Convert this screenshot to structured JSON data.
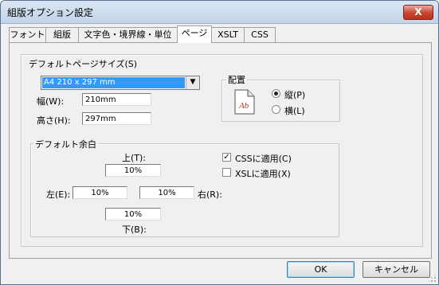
{
  "window": {
    "title": "組版オプション設定",
    "close_label": "X"
  },
  "tabs": [
    {
      "label": "フォント",
      "active": false
    },
    {
      "label": "組版",
      "active": false
    },
    {
      "label": "文字色・境界線・単位",
      "active": false
    },
    {
      "label": "ページ",
      "active": true
    },
    {
      "label": "XSLT",
      "active": false
    },
    {
      "label": "CSS",
      "active": false
    }
  ],
  "page_size": {
    "group_label": "デフォルトページサイズ(S)",
    "selected": "A4 210 x 297 mm",
    "width_label": "幅(W):",
    "width_value": "210mm",
    "height_label": "高さ(H):",
    "height_value": "297mm"
  },
  "orientation": {
    "group_label": "配置",
    "page_icon_text": "Ab",
    "portrait_label": "縦(P)",
    "landscape_label": "横(L)",
    "selected": "portrait"
  },
  "margins": {
    "group_label": "デフォルト余白",
    "top_label": "上(T):",
    "top_value": "10%",
    "left_label": "左(E):",
    "left_value": "10%",
    "right_label": "右(R):",
    "right_value": "10%",
    "bottom_label": "下(B):",
    "bottom_value": "10%",
    "css_label": "CSSに適用(C)",
    "css_checked": true,
    "xsl_label": "XSLに適用(X)",
    "xsl_checked": false,
    "check_mark": "✓"
  },
  "buttons": {
    "ok": "OK",
    "cancel": "キャンセル"
  },
  "colors": {
    "selection": "#3399ff",
    "close_button": "#c9452f",
    "page_icon_text": "#c0392b"
  }
}
